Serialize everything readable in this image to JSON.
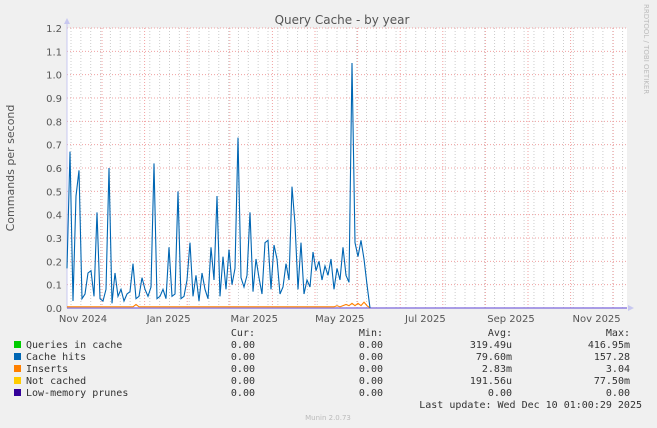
{
  "chart_data": {
    "type": "line",
    "title": "Query Cache - by year",
    "ylabel": "Commands per second",
    "ylim": [
      0,
      1.2
    ],
    "yticks": [
      "0.0",
      "0.1",
      "0.2",
      "0.3",
      "0.4",
      "0.5",
      "0.6",
      "0.7",
      "0.8",
      "0.9",
      "1.0",
      "1.1",
      "1.2"
    ],
    "xtick_labels": [
      "Nov 2024",
      "Jan 2025",
      "Mar 2025",
      "May 2025",
      "Jul 2025",
      "Sep 2025",
      "Nov 2025"
    ],
    "grid": true,
    "watermark": "RRDTOOL / TOBI OETIKER",
    "series": [
      {
        "name": "Cache hits",
        "color": "#0066b3",
        "values": [
          0.17,
          0.67,
          0.03,
          0.48,
          0.59,
          0.04,
          0.06,
          0.15,
          0.16,
          0.05,
          0.41,
          0.04,
          0.03,
          0.08,
          0.6,
          0.02,
          0.15,
          0.05,
          0.08,
          0.03,
          0.06,
          0.07,
          0.19,
          0.04,
          0.05,
          0.13,
          0.08,
          0.05,
          0.09,
          0.62,
          0.04,
          0.05,
          0.08,
          0.04,
          0.26,
          0.05,
          0.06,
          0.5,
          0.04,
          0.05,
          0.12,
          0.28,
          0.05,
          0.14,
          0.03,
          0.15,
          0.08,
          0.04,
          0.26,
          0.12,
          0.48,
          0.05,
          0.22,
          0.08,
          0.25,
          0.1,
          0.17,
          0.73,
          0.13,
          0.09,
          0.14,
          0.41,
          0.07,
          0.21,
          0.13,
          0.06,
          0.28,
          0.29,
          0.08,
          0.27,
          0.21,
          0.06,
          0.09,
          0.19,
          0.12,
          0.52,
          0.36,
          0.08,
          0.28,
          0.06,
          0.12,
          0.09,
          0.24,
          0.16,
          0.2,
          0.12,
          0.18,
          0.14,
          0.21,
          0.08,
          0.17,
          0.12,
          0.26,
          0.14,
          0.11,
          1.05,
          0.28,
          0.22,
          0.29,
          0.21,
          0.1,
          0.0
        ]
      },
      {
        "name": "Inserts",
        "color": "#ff8000",
        "values": [
          0.005,
          0.005,
          0.005,
          0.005,
          0.005,
          0.005,
          0.005,
          0.005,
          0.005,
          0.005,
          0.005,
          0.005,
          0.005,
          0.005,
          0.005,
          0.005,
          0.005,
          0.005,
          0.005,
          0.005,
          0.005,
          0.005,
          0.005,
          0.015,
          0.005,
          0.005,
          0.005,
          0.005,
          0.005,
          0.005,
          0.005,
          0.005,
          0.005,
          0.005,
          0.005,
          0.005,
          0.005,
          0.005,
          0.005,
          0.005,
          0.005,
          0.005,
          0.005,
          0.005,
          0.005,
          0.005,
          0.005,
          0.005,
          0.005,
          0.005,
          0.005,
          0.005,
          0.005,
          0.005,
          0.005,
          0.005,
          0.005,
          0.005,
          0.005,
          0.005,
          0.005,
          0.005,
          0.005,
          0.005,
          0.005,
          0.005,
          0.005,
          0.005,
          0.005,
          0.005,
          0.005,
          0.005,
          0.005,
          0.005,
          0.005,
          0.005,
          0.005,
          0.005,
          0.005,
          0.005,
          0.005,
          0.005,
          0.005,
          0.005,
          0.005,
          0.005,
          0.005,
          0.005,
          0.005,
          0.005,
          0.01,
          0.005,
          0.01,
          0.015,
          0.01,
          0.02,
          0.01,
          0.02,
          0.01,
          0.025,
          0.01,
          0.0
        ]
      },
      {
        "name": "Low-memory prunes",
        "color": "#330099",
        "values": [
          0,
          0
        ]
      }
    ]
  },
  "legend": {
    "headers": {
      "cur": "Cur:",
      "min": "Min:",
      "avg": "Avg:",
      "max": "Max:"
    },
    "rows": [
      {
        "label": "Queries in cache",
        "color": "#00cc00",
        "cur": "0.00",
        "min": "0.00",
        "avg": "319.49u",
        "max": "416.95m"
      },
      {
        "label": "Cache hits",
        "color": "#0066b3",
        "cur": "0.00",
        "min": "0.00",
        "avg": "79.60m",
        "max": "157.28"
      },
      {
        "label": "Inserts",
        "color": "#ff8000",
        "cur": "0.00",
        "min": "0.00",
        "avg": "2.83m",
        "max": "3.04"
      },
      {
        "label": "Not cached",
        "color": "#ffcc00",
        "cur": "0.00",
        "min": "0.00",
        "avg": "191.56u",
        "max": "77.50m"
      },
      {
        "label": "Low-memory prunes",
        "color": "#330099",
        "cur": "0.00",
        "min": "0.00",
        "avg": "0.00",
        "max": "0.00"
      }
    ],
    "last_update": "Last update: Wed Dec 10 01:00:29 2025"
  },
  "footer": {
    "version": "Munin 2.0.73"
  }
}
